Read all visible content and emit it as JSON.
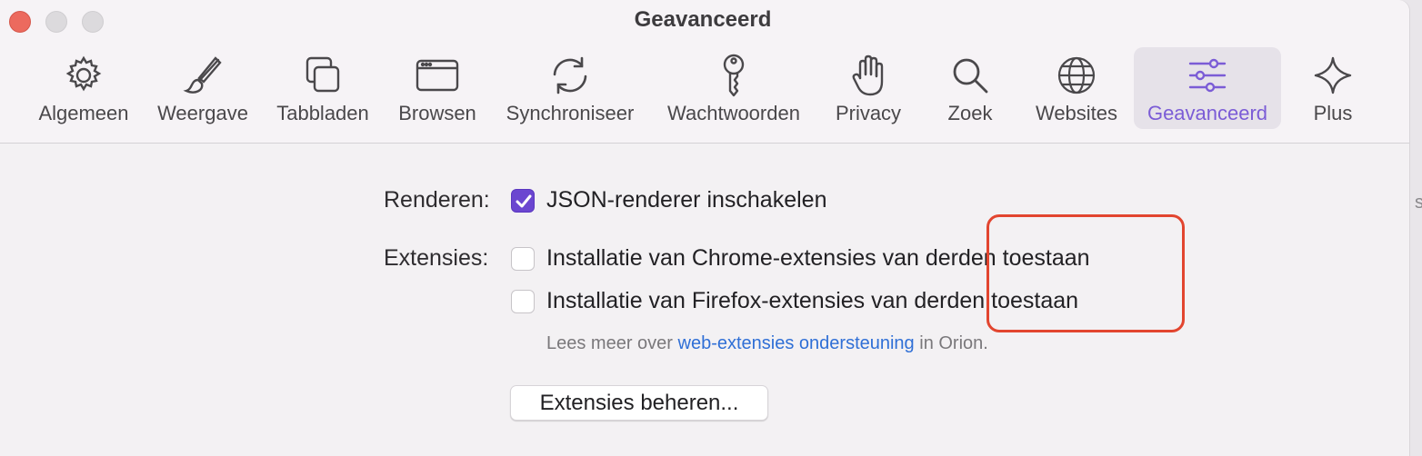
{
  "window": {
    "title": "Geavanceerd"
  },
  "toolbar": {
    "items": [
      {
        "label": "Algemeen",
        "icon": "gear-icon"
      },
      {
        "label": "Weergave",
        "icon": "paintbrush-icon"
      },
      {
        "label": "Tabbladen",
        "icon": "tabs-icon"
      },
      {
        "label": "Browsen",
        "icon": "browser-window-icon"
      },
      {
        "label": "Synchroniseer",
        "icon": "sync-icon"
      },
      {
        "label": "Wachtwoorden",
        "icon": "key-icon"
      },
      {
        "label": "Privacy",
        "icon": "hand-icon"
      },
      {
        "label": "Zoek",
        "icon": "magnifier-icon"
      },
      {
        "label": "Websites",
        "icon": "globe-icon"
      },
      {
        "label": "Geavanceerd",
        "icon": "sliders-icon",
        "selected": true
      },
      {
        "label": "Plus",
        "icon": "sparkle-icon"
      }
    ]
  },
  "settings": {
    "rendering_label": "Renderen:",
    "json_renderer": {
      "label": "JSON-renderer inschakelen",
      "checked": true
    },
    "extensions_label": "Extensies:",
    "chrome_ext": {
      "label": "Installatie van Chrome-extensies van derden toestaan",
      "checked": false
    },
    "firefox_ext": {
      "label": "Installatie van Firefox-extensies van derden toestaan",
      "checked": false
    },
    "hint_prefix": "Lees meer over ",
    "hint_link": "web-extensies ondersteuning",
    "hint_suffix": " in Orion.",
    "manage_button": "Extensies beheren..."
  },
  "edge_text": "s",
  "colors": {
    "accent": "#7b5cd6",
    "checkbox": "#6b46d0",
    "link": "#2f6fd6",
    "annotation": "#e2452f"
  }
}
